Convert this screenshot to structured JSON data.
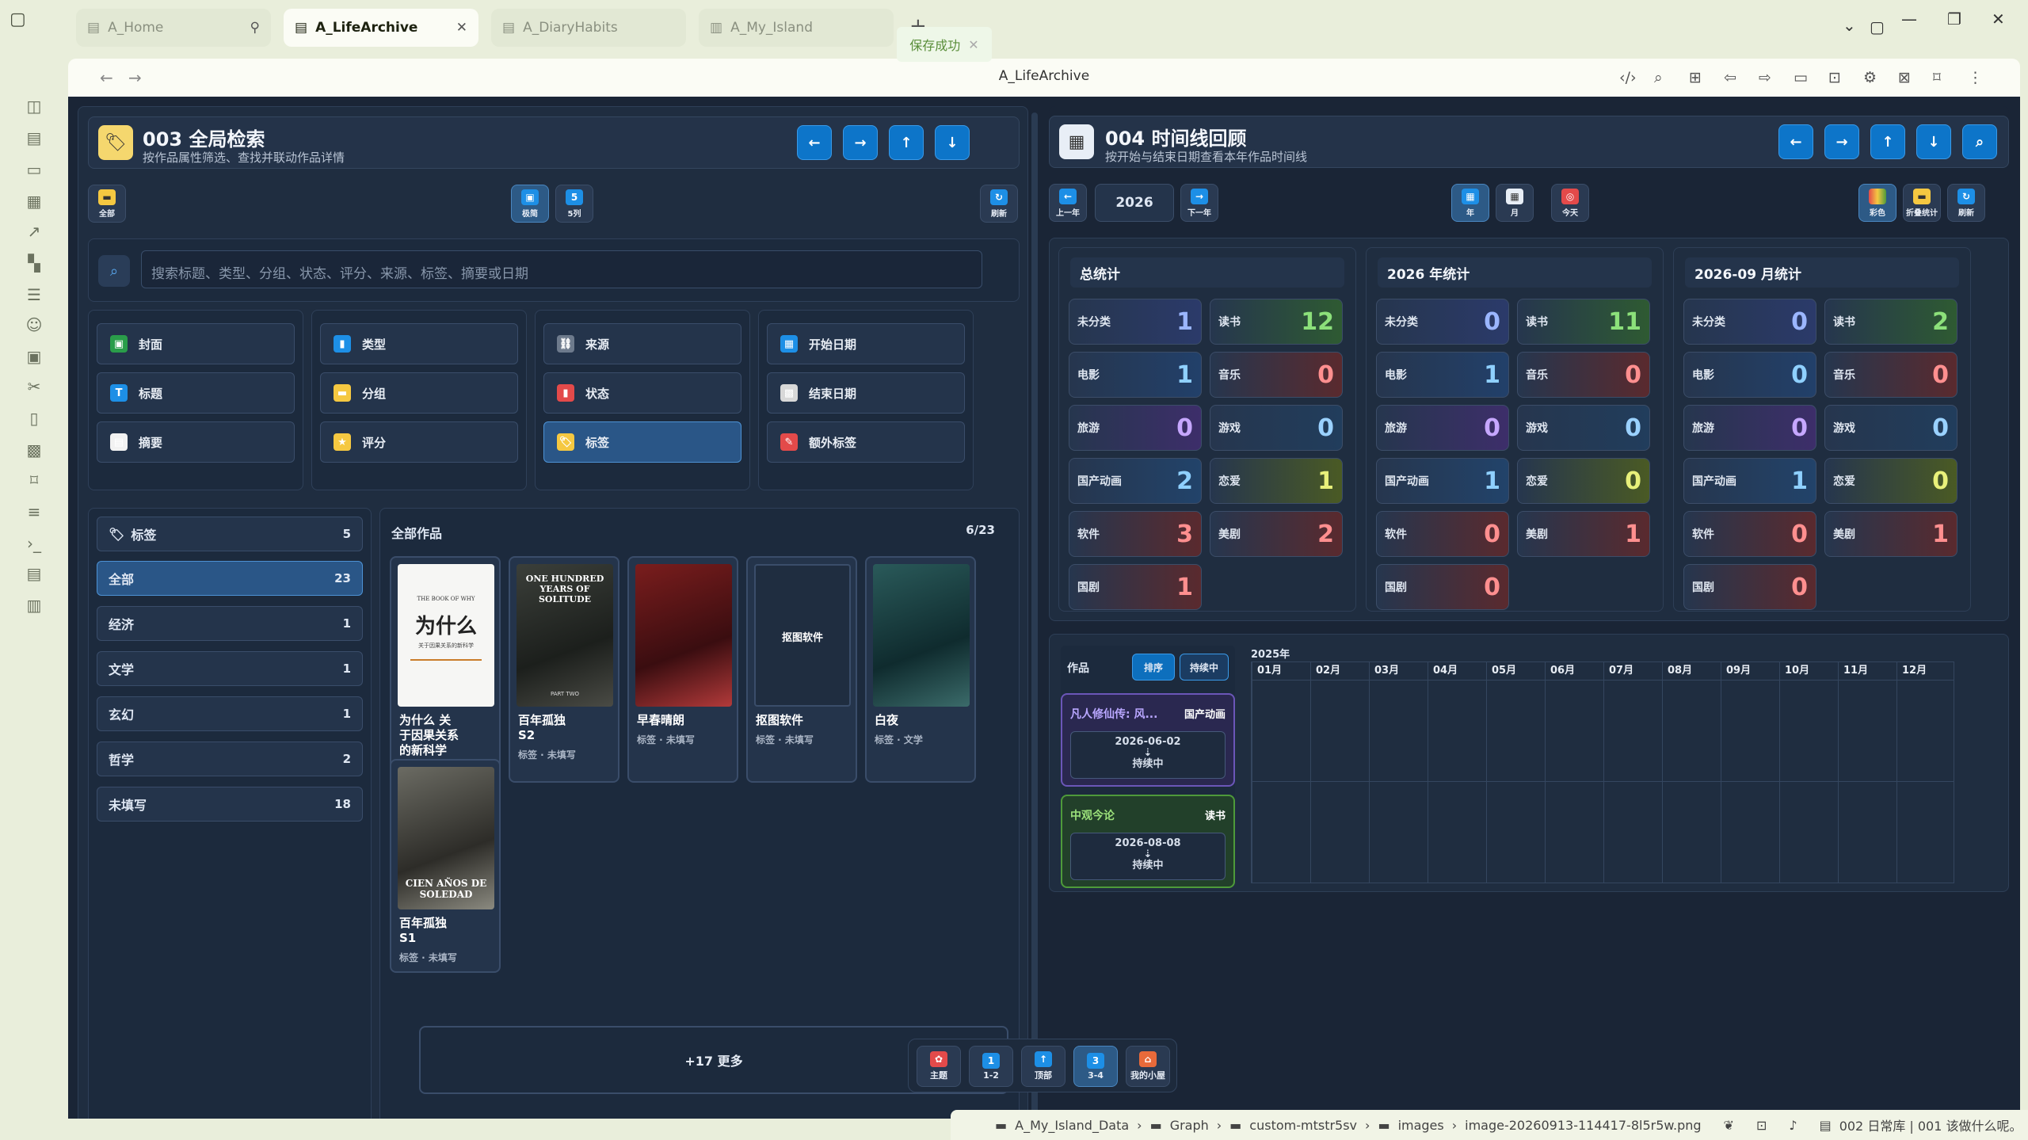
{
  "tabs": [
    {
      "label": "A_Home",
      "pinned": true
    },
    {
      "label": "A_LifeArchive",
      "active": true
    },
    {
      "label": "A_DiaryHabits"
    },
    {
      "label": "A_My_Island"
    }
  ],
  "nav": {
    "title": "A_LifeArchive"
  },
  "toast": {
    "text": "保存成功"
  },
  "left": {
    "title": "003 全局检索",
    "subtitle": "按作品属性筛选、查找并联动作品详情",
    "tb_all": "全部",
    "tb_cover": "极简",
    "tb_cols": "5列",
    "tb_cols_num": "5",
    "tb_refresh": "刷新",
    "search_placeholder": "搜索标题、类型、分组、状态、评分、来源、标签、摘要或日期",
    "filters": [
      [
        "封面",
        "标题",
        "摘要"
      ],
      [
        "类型",
        "分组",
        "评分"
      ],
      [
        "来源",
        "状态",
        "标签"
      ],
      [
        "开始日期",
        "结束日期",
        "额外标签"
      ]
    ],
    "tag_panel_title": "标签",
    "tag_panel_count": "5",
    "tags": [
      {
        "label": "全部",
        "count": "23"
      },
      {
        "label": "经济",
        "count": "1"
      },
      {
        "label": "文学",
        "count": "1"
      },
      {
        "label": "玄幻",
        "count": "1"
      },
      {
        "label": "哲学",
        "count": "2"
      },
      {
        "label": "未填写",
        "count": "18"
      }
    ],
    "works_title": "全部作品",
    "works_count": "6/23",
    "works": [
      {
        "title": "为什么 关\n于因果关系\n的新科学",
        "meta": "标签 · 未填写",
        "poster_text": "为什么",
        "poster_sub": "关于因果关系的新科学",
        "poster_en": "THE BOOK OF WHY"
      },
      {
        "title": "百年孤独\nS2",
        "meta": "标签 · 未填写",
        "poster_text": "ONE HUNDRED YEARS OF SOLITUDE",
        "poster_sub": "PART TWO"
      },
      {
        "title": "早春晴朗",
        "meta": "标签 · 未填写"
      },
      {
        "title": "抠图软件",
        "meta": "标签 · 未填写",
        "poster_text": "抠图软件"
      },
      {
        "title": "白夜",
        "meta": "标签 · 文学"
      },
      {
        "title": "百年孤独\nS1",
        "meta": "标签 · 未填写",
        "poster_text": "CIEN AÑOS DE SOLEDAD"
      }
    ],
    "more": "+17 更多"
  },
  "right": {
    "title": "004 时间线回顾",
    "subtitle": "按开始与结束日期查看本年作品时间线",
    "prev_year": "上一年",
    "year": "2026",
    "next_year": "下一年",
    "tb_year": "年",
    "tb_month": "月",
    "tb_today": "今天",
    "tb_color": "彩色",
    "tb_stats": "折叠统计",
    "tb_refresh": "刷新",
    "stats": [
      {
        "title": "总统计",
        "items": [
          {
            "label": "未分类",
            "value": "1"
          },
          {
            "label": "读书",
            "value": "12"
          },
          {
            "label": "电影",
            "value": "1"
          },
          {
            "label": "音乐",
            "value": "0"
          },
          {
            "label": "旅游",
            "value": "0"
          },
          {
            "label": "游戏",
            "value": "0"
          },
          {
            "label": "国产动画",
            "value": "2"
          },
          {
            "label": "恋爱",
            "value": "1"
          },
          {
            "label": "软件",
            "value": "3"
          },
          {
            "label": "美剧",
            "value": "2"
          },
          {
            "label": "国剧",
            "value": "1"
          }
        ]
      },
      {
        "title": "2026 年统计",
        "items": [
          {
            "label": "未分类",
            "value": "0"
          },
          {
            "label": "读书",
            "value": "11"
          },
          {
            "label": "电影",
            "value": "1"
          },
          {
            "label": "音乐",
            "value": "0"
          },
          {
            "label": "旅游",
            "value": "0"
          },
          {
            "label": "游戏",
            "value": "0"
          },
          {
            "label": "国产动画",
            "value": "1"
          },
          {
            "label": "恋爱",
            "value": "0"
          },
          {
            "label": "软件",
            "value": "0"
          },
          {
            "label": "美剧",
            "value": "1"
          },
          {
            "label": "国剧",
            "value": "0"
          }
        ]
      },
      {
        "title": "2026-09 月统计",
        "items": [
          {
            "label": "未分类",
            "value": "0"
          },
          {
            "label": "读书",
            "value": "2"
          },
          {
            "label": "电影",
            "value": "0"
          },
          {
            "label": "音乐",
            "value": "0"
          },
          {
            "label": "旅游",
            "value": "0"
          },
          {
            "label": "游戏",
            "value": "0"
          },
          {
            "label": "国产动画",
            "value": "1"
          },
          {
            "label": "恋爱",
            "value": "0"
          },
          {
            "label": "软件",
            "value": "0"
          },
          {
            "label": "美剧",
            "value": "1"
          },
          {
            "label": "国剧",
            "value": "0"
          }
        ]
      }
    ],
    "timeline": {
      "works_label": "作品",
      "sort_btn": "排序",
      "ongoing_btn": "持续中",
      "year_label": "2025年",
      "months": [
        "01月",
        "02月",
        "03月",
        "04月",
        "05月",
        "06月",
        "07月",
        "08月",
        "09月",
        "10月",
        "11月",
        "12月"
      ],
      "items": [
        {
          "title": "凡人修仙传: 风...",
          "type": "国产动画",
          "date": "2026-06-02",
          "status": "持续中",
          "color": "#6b56b8"
        },
        {
          "title": "中观今论",
          "type": "读书",
          "date": "2026-08-08",
          "status": "持续中",
          "color": "#4e9a3a"
        }
      ]
    }
  },
  "dock": [
    {
      "label": "主题"
    },
    {
      "label": "1-2",
      "num": "1"
    },
    {
      "label": "顶部"
    },
    {
      "label": "3-4",
      "num": "3",
      "active": true
    },
    {
      "label": "我的小屋"
    }
  ],
  "statusbar": {
    "path": [
      "A_My_Island_Data",
      "Graph",
      "custom-mtstr5sv",
      "images",
      "image-20260913-114417-8l5r5w.png"
    ],
    "right_text": "002 日常库 | 001 该做什么呢。"
  },
  "colors": {
    "accent_blue": "#0d75c9",
    "bg": "#1a2536",
    "chrome": "#e9eedb"
  }
}
